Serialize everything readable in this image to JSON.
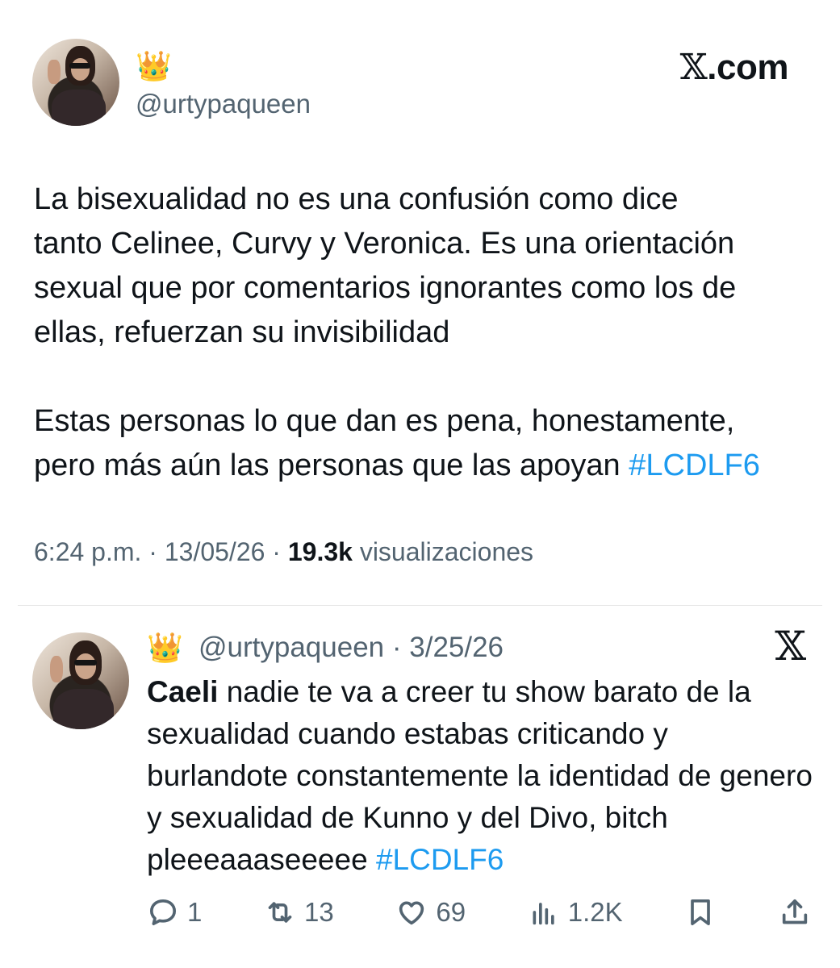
{
  "site": {
    "logo_x": "𝕏",
    "logo_text": ".com"
  },
  "tweet": {
    "crown_emoji": "👑",
    "handle": "@urtypaqueen",
    "paragraph1": "La bisexualidad no es una confusión como dice\ntanto Celinee, Curvy y Veronica. Es una orientación\nsexual que por comentarios ignorantes como los de\nellas, refuerzan su invisibilidad",
    "paragraph2": "Estas personas lo que dan es pena, honestamente,\npero más aún las personas que las apoyan ",
    "hashtag": "#LCDLF6",
    "time": "6:24 p.m.",
    "separator": " · ",
    "date": "13/05/26",
    "views_count": "19.3k",
    "views_label": " visualizaciones"
  },
  "quoted": {
    "crown_emoji": "👑",
    "handle": "@urtypaqueen",
    "date": "3/25/26",
    "separator": " · ",
    "x_icon": "𝕏",
    "mention_name": "Caeli",
    "text": " nadie te va a creer tu show barato de la sexualidad cuando estabas criticando y burlandote constantemente la identidad de genero y sexualidad de Kunno y del Divo, bitch pleeeaaaseeeee ",
    "hashtag": "#LCDLF6",
    "stats": {
      "replies": "1",
      "reposts": "13",
      "likes": "69",
      "views": "1.2K"
    }
  }
}
